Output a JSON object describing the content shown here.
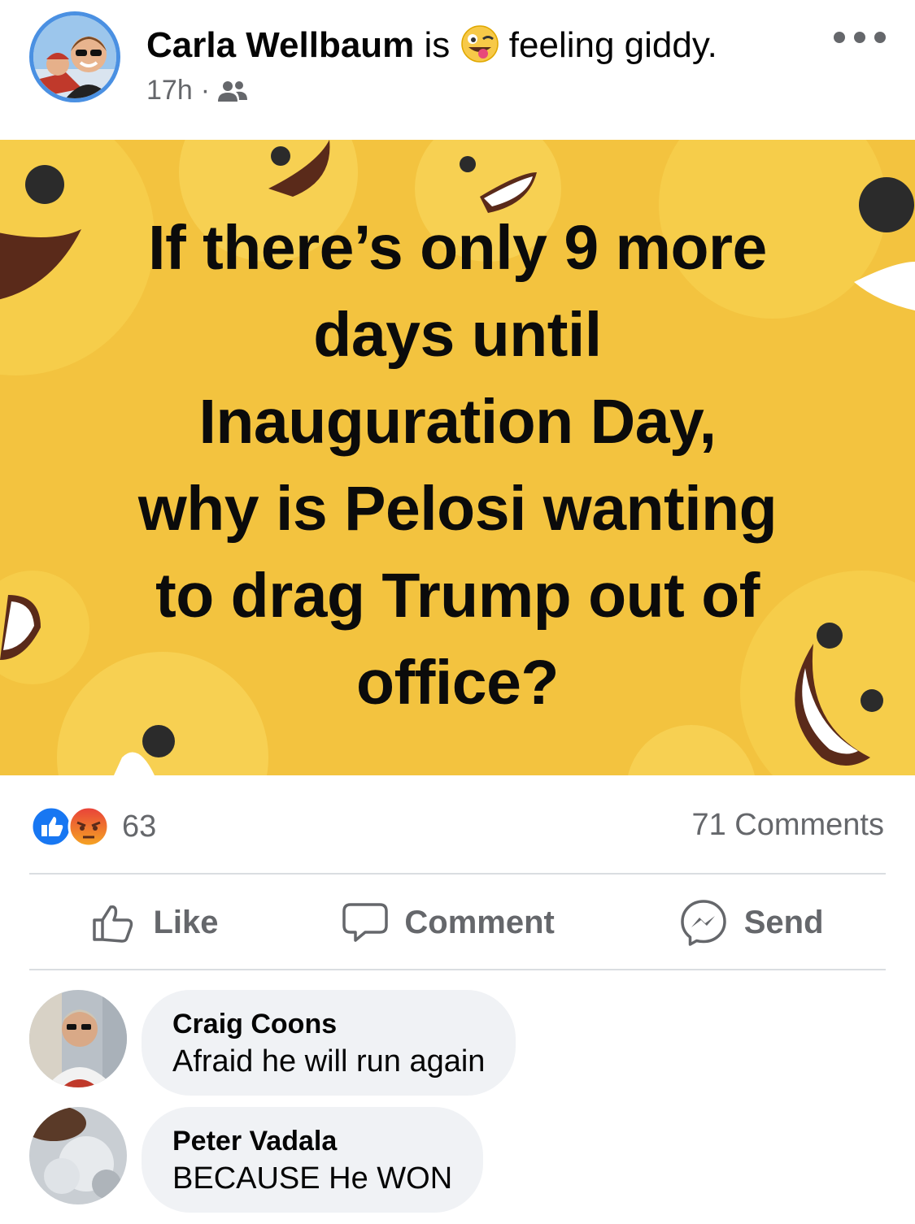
{
  "post": {
    "author": "Carla Wellbaum",
    "activity_prefix": "is",
    "activity": "feeling giddy.",
    "timestamp": "17h",
    "meta_separator": "·",
    "audience_icon": "friends-icon",
    "image_text": [
      "If there’s only 9 more",
      "days until",
      "Inauguration Day,",
      "why is Pelosi wanting",
      "to drag Trump out of",
      "office?"
    ],
    "image_bg_color": "#f3c33f"
  },
  "stats": {
    "reaction_count": "63",
    "reaction_icons": [
      "like-icon",
      "angry-icon"
    ],
    "comments_label": "71 Comments"
  },
  "actions": {
    "like": "Like",
    "comment": "Comment",
    "send": "Send"
  },
  "comments": [
    {
      "name": "Craig Coons",
      "text": "Afraid he will run again"
    },
    {
      "name": "Peter Vadala",
      "text": "BECAUSE He WON"
    }
  ],
  "colors": {
    "accent": "#1877f2",
    "secondary_text": "#65676b",
    "bubble": "#f0f2f5",
    "angry": "#f5803d"
  }
}
